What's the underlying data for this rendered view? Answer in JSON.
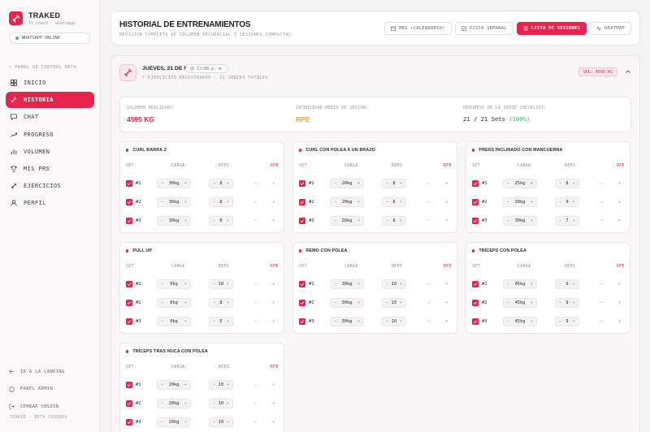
{
  "colors": {
    "accent": "#e8234d",
    "online": "#2fbf71",
    "rpe": "#f0a23a"
  },
  "sidebar": {
    "brand_name": "TRAKED",
    "brand_sub": "Tu coach · whatsapp",
    "whatsapp_status": "WHATSAPP ONLINE",
    "panel_label": "< PANEL DE CONTROL BETA",
    "items": [
      {
        "label": "INICIO",
        "icon": "grid-icon"
      },
      {
        "label": "HISTORIA",
        "icon": "dumbbell-icon",
        "active": true
      },
      {
        "label": "CHAT",
        "icon": "chat-icon"
      },
      {
        "label": "PROGRESO",
        "icon": "trend-icon"
      },
      {
        "label": "VOLUMEN",
        "icon": "bar-chart-icon"
      },
      {
        "label": "MIS PRS",
        "icon": "trophy-icon"
      },
      {
        "label": "EJERCICIOS",
        "icon": "dumbbell-icon"
      },
      {
        "label": "PERFIL",
        "icon": "user-icon"
      }
    ],
    "bottom_links": [
      {
        "label": "IR A LA LANDING",
        "icon": "arrow-left-icon"
      },
      {
        "label": "PANEL ADMIN",
        "icon": "shield-icon"
      },
      {
        "label": "CERRAR SESIÓN",
        "icon": "logout-icon"
      }
    ],
    "footer": "TRAKED - BETA CERRADA"
  },
  "header": {
    "title": "HISTORIAL DE ENTRENAMIENTOS",
    "subtitle": "REVISIÓN COMPLETA DE VOLUMEN SECUENCIAL Y SESIONES COMPACTAS",
    "views": [
      {
        "label": "MES (CALENDARIO)",
        "icon": "calendar-icon"
      },
      {
        "label": "VISTA SEMANAL",
        "icon": "week-icon"
      },
      {
        "label": "LISTA DE SESIONES",
        "icon": "list-icon",
        "active": true
      },
      {
        "label": "HEATMAP",
        "icon": "pulse-icon"
      }
    ]
  },
  "session": {
    "date": "JUEVES, 21 DE MAYO",
    "time": "12:00 p. m.",
    "meta": "7 EJERCICIOS REGISTRADOS · 21 SERIES TOTALES",
    "volume_badge": "VOL: 4595 KG",
    "stats": {
      "volume_label": "VOLUMEN REALIZADO:",
      "volume_value": "4595 KG",
      "intensity_label": "INTENSIDAD MEDIA DE SESIÓN:",
      "intensity_value": "RPE",
      "progress_label": "PROGRESO DE LA SERIE CHECKLIST:",
      "progress_value": "21 / 21 Sets",
      "progress_pct": "(100%)"
    },
    "table_headers": {
      "set": "SET",
      "load": "CARGA",
      "reps": "REPS",
      "rpe": "RPE"
    },
    "exercises": [
      {
        "name": "CURL BARRA Z",
        "sets": [
          {
            "num": "#1",
            "load": "30kg",
            "reps": "8"
          },
          {
            "num": "#2",
            "load": "30kg",
            "reps": "8"
          },
          {
            "num": "#3",
            "load": "30kg",
            "reps": "8"
          }
        ]
      },
      {
        "name": "CURL CON POLEA A UN BRAZO",
        "sets": [
          {
            "num": "#1",
            "load": "20kg",
            "reps": "8"
          },
          {
            "num": "#2",
            "load": "20kg",
            "reps": "8"
          },
          {
            "num": "#3",
            "load": "20kg",
            "reps": "8"
          }
        ]
      },
      {
        "name": "PRESS INCLINADO CON MANCUERNA",
        "sets": [
          {
            "num": "#1",
            "load": "25kg",
            "reps": "8"
          },
          {
            "num": "#2",
            "load": "30kg",
            "reps": "9"
          },
          {
            "num": "#3",
            "load": "30kg",
            "reps": "7"
          }
        ]
      },
      {
        "name": "PULL UP",
        "sets": [
          {
            "num": "#1",
            "load": "0kg",
            "reps": "10"
          },
          {
            "num": "#2",
            "load": "0kg",
            "reps": "8"
          },
          {
            "num": "#3",
            "load": "0kg",
            "reps": "6"
          }
        ]
      },
      {
        "name": "REMO CON POLEA",
        "sets": [
          {
            "num": "#1",
            "load": "30kg",
            "reps": "10"
          },
          {
            "num": "#2",
            "load": "30kg",
            "reps": "10"
          },
          {
            "num": "#3",
            "load": "30kg",
            "reps": "10"
          }
        ]
      },
      {
        "name": "TRÍCEPS CON POLEA",
        "sets": [
          {
            "num": "#1",
            "load": "45kg",
            "reps": "9"
          },
          {
            "num": "#2",
            "load": "45kg",
            "reps": "9"
          },
          {
            "num": "#3",
            "load": "45kg",
            "reps": "9"
          }
        ]
      },
      {
        "name": "TRÍCEPS TRAS NUCA CON POLEA",
        "sets": [
          {
            "num": "#1",
            "load": "20kg",
            "reps": "10"
          },
          {
            "num": "#2",
            "load": "20kg",
            "reps": "10"
          },
          {
            "num": "#3",
            "load": "20kg",
            "reps": "10"
          }
        ]
      }
    ]
  }
}
